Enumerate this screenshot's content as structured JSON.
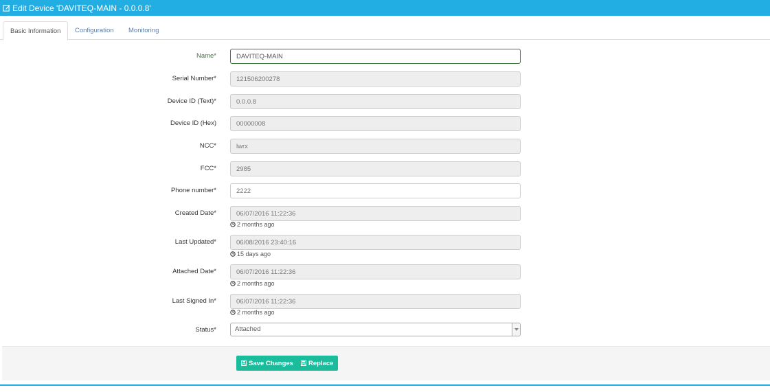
{
  "header": {
    "title": "Edit Device 'DAVITEQ-MAIN - 0.0.0.8'",
    "icon": "edit-icon",
    "color": "#23aee3"
  },
  "tabs": [
    {
      "label": "Basic Information",
      "active": true
    },
    {
      "label": "Configuration",
      "active": false
    },
    {
      "label": "Monitoring",
      "active": false
    }
  ],
  "form": {
    "name": {
      "label": "Name*",
      "value": "DAVITEQ-MAIN"
    },
    "serial_number": {
      "label": "Serial Number*",
      "value": "121506200278"
    },
    "device_id_text": {
      "label": "Device ID (Text)*",
      "value": "0.0.0.8"
    },
    "device_id_hex": {
      "label": "Device ID (Hex)",
      "value": "00000008"
    },
    "ncc": {
      "label": "NCC*",
      "value": "lwrx"
    },
    "fcc": {
      "label": "FCC*",
      "value": "2985"
    },
    "phone_number": {
      "label": "Phone number*",
      "value": "2222"
    },
    "created_date": {
      "label": "Created Date*",
      "value": "06/07/2016 11:22:36",
      "relative": "2 months ago"
    },
    "last_updated": {
      "label": "Last Updated*",
      "value": "06/08/2016 23:40:16",
      "relative": "15 days ago"
    },
    "attached_date": {
      "label": "Attached Date*",
      "value": "06/07/2016 11:22:36",
      "relative": "2 months ago"
    },
    "last_signed_in": {
      "label": "Last Signed In*",
      "value": "06/07/2016 11:22:36",
      "relative": "2 months ago"
    },
    "status": {
      "label": "Status*",
      "value": "Attached"
    }
  },
  "actions": {
    "save_label": "Save Changes",
    "replace_label": "Replace",
    "color": "#1bbc9b"
  }
}
